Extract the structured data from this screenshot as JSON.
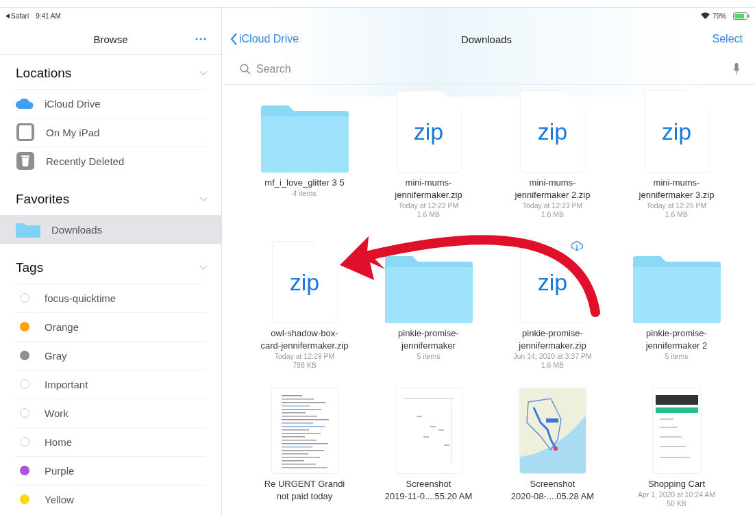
{
  "status_bar": {
    "back_app": "Safari",
    "time": "9:41 AM",
    "battery": "79%"
  },
  "sidebar": {
    "title": "Browse",
    "sections": [
      {
        "title": "Locations",
        "expanded": true,
        "items": [
          {
            "label": "iCloud Drive",
            "kind": "cloud",
            "selected": false
          },
          {
            "label": "On My iPad",
            "kind": "device",
            "selected": false
          },
          {
            "label": "Recently Deleted",
            "kind": "trash",
            "selected": false
          }
        ]
      },
      {
        "title": "Favorites",
        "expanded": true,
        "items": [
          {
            "label": "Downloads",
            "kind": "folder",
            "selected": true
          }
        ]
      },
      {
        "title": "Tags",
        "expanded": true,
        "items": [
          {
            "label": "focus-quicktime",
            "kind": "tag",
            "selected": false
          },
          {
            "label": "Orange",
            "kind": "tag",
            "color": "#ff9f0a",
            "selected": false
          },
          {
            "label": "Gray",
            "kind": "tag",
            "color": "#8e8e93",
            "selected": false
          },
          {
            "label": "Important",
            "kind": "tag",
            "selected": false
          },
          {
            "label": "Work",
            "kind": "tag",
            "selected": false
          },
          {
            "label": "Home",
            "kind": "tag",
            "selected": false
          },
          {
            "label": "Purple",
            "kind": "tag",
            "color": "#af52de",
            "selected": false
          },
          {
            "label": "Yellow",
            "kind": "tag",
            "color": "#ffd60a",
            "selected": false
          }
        ]
      }
    ]
  },
  "nav": {
    "back": "iCloud Drive",
    "title": "Downloads",
    "action": "Select"
  },
  "search": {
    "placeholder": "Search"
  },
  "files": [
    {
      "kind": "folder",
      "name": "mf_i_love_glitter 3 5",
      "details": [
        "4 items"
      ],
      "in_cloud": false
    },
    {
      "kind": "zip",
      "icon_text": "zip",
      "name": "mini-mums-\njennifermaker.zip",
      "details": [
        "Today at 12:22 PM",
        "1.6 MB"
      ],
      "in_cloud": false
    },
    {
      "kind": "zip",
      "icon_text": "zip",
      "name": "mini-mums-\njennifermaker 2.zip",
      "details": [
        "Today at 12:23 PM",
        "1.6 MB"
      ],
      "in_cloud": false
    },
    {
      "kind": "zip",
      "icon_text": "zip",
      "name": "mini-mums-\njennifermaker 3.zip",
      "details": [
        "Today at 12:25 PM",
        "1.6 MB"
      ],
      "in_cloud": false
    },
    {
      "kind": "zip",
      "icon_text": "zip",
      "name": "owl-shadow-box-\ncard-jennifermaker.zip",
      "details": [
        "Today at 12:29 PM",
        "788 KB"
      ],
      "in_cloud": false
    },
    {
      "kind": "folder",
      "name": "pinkie-promise-\njennifermaker",
      "details": [
        "5 items"
      ],
      "in_cloud": false
    },
    {
      "kind": "zip",
      "icon_text": "zip",
      "name": "pinkie-promise-\njennifermaker.zip",
      "details": [
        "Jun 14, 2020 at 3:37 PM",
        "1.6 MB"
      ],
      "in_cloud": true
    },
    {
      "kind": "folder",
      "name": "pinkie-promise-\njennifermaker 2",
      "details": [
        "5 items"
      ],
      "in_cloud": false
    },
    {
      "kind": "document",
      "name": "Re  URGENT Grandi\nnot paid today",
      "in_cloud": false
    },
    {
      "kind": "screenshot",
      "name": "Screenshot\n2019-11-0....55.20 AM",
      "in_cloud": false
    },
    {
      "kind": "map",
      "name": "Screenshot\n2020-08-....05.28 AM",
      "in_cloud": false
    },
    {
      "kind": "phone",
      "name": "Shopping Cart",
      "details": [
        "Apr 1, 2020 at 10:24 AM",
        "50 KB"
      ],
      "in_cloud": false
    }
  ]
}
